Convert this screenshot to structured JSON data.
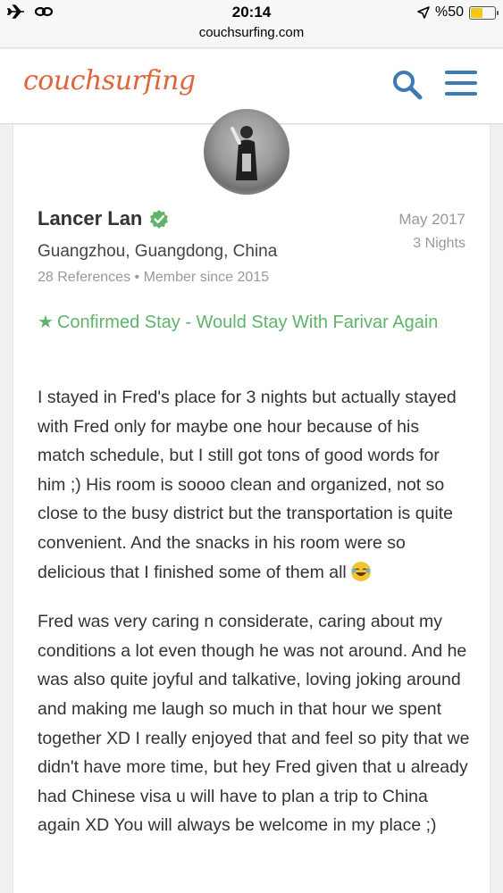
{
  "status_bar": {
    "time": "20:14",
    "battery": "%50",
    "battery_level": 0.5,
    "icons": [
      "airplane-icon",
      "link-icon",
      "location-arrow-icon",
      "battery-icon"
    ]
  },
  "browser": {
    "url": "couchsurfing.com"
  },
  "header": {
    "logo": "couchsurfing",
    "brand_color": "#e0643a",
    "icon_color": "#3b7bb3",
    "icons": [
      "search-icon",
      "menu-icon"
    ]
  },
  "review": {
    "name": "Lancer Lan",
    "location": "Guangzhou, Guangdong, China",
    "references": "28 References",
    "member_since": "Member since 2015",
    "date": "May 2017",
    "nights": "3 Nights",
    "confirmed_text": "Confirmed Stay - Would Stay With Farivar Again",
    "confirmed_color": "#5fb36a",
    "paragraph_1": "I stayed in Fred's place for 3 nights but actually stayed with Fred only for maybe one hour because of his match schedule, but I still got tons of good words for him ;) His room is soooo clean and organized, not so close to the busy district but the transportation is quite convenient. And the snacks in his room were so delicious that I finished some of them all",
    "paragraph_2": "Fred was very caring n considerate, caring about my conditions a lot even though he was not around. And he was also quite joyful and talkative, loving joking around and making me laugh so much in that hour we spent together XD I really enjoyed that and feel so pity that we didn't have more time, but hey Fred given that u already had Chinese visa u will have to plan a trip to China again XD You will always be welcome in my place ;)"
  }
}
